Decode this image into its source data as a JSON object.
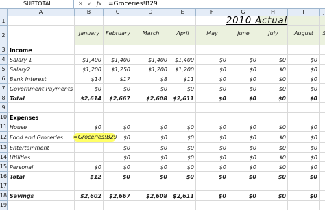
{
  "formula_bar": {
    "name_box": "SUBTOTAL",
    "cancel_icon": "✕",
    "enter_icon": "✓",
    "fx_label": "fx",
    "formula": "=Groceries!B29"
  },
  "columns": [
    "A",
    "B",
    "C",
    "D",
    "E",
    "F",
    "G",
    "H",
    "I",
    "J"
  ],
  "rows": [
    "1",
    "2",
    "3",
    "4",
    "5",
    "6",
    "7",
    "8",
    "9",
    "10",
    "11",
    "12",
    "13",
    "14",
    "15",
    "16",
    "17",
    "18",
    "19"
  ],
  "title": "2010 Actual",
  "months": [
    "January",
    "February",
    "March",
    "April",
    "May",
    "June",
    "July",
    "August",
    "S"
  ],
  "income": {
    "header": "Income",
    "rows": [
      {
        "label": "Salary 1",
        "values": [
          "$1,400",
          "$1,400",
          "$1,400",
          "$1,400",
          "$0",
          "$0",
          "$0",
          "$0"
        ]
      },
      {
        "label": "Salary2",
        "values": [
          "$1,200",
          "$1,250",
          "$1,200",
          "$1,200",
          "$0",
          "$0",
          "$0",
          "$0"
        ]
      },
      {
        "label": "Bank Interest",
        "values": [
          "$14",
          "$17",
          "$8",
          "$11",
          "$0",
          "$0",
          "$0",
          "$0"
        ]
      },
      {
        "label": "Government Payments",
        "values": [
          "$0",
          "$0",
          "$0",
          "$0",
          "$0",
          "$0",
          "$0",
          "$0"
        ]
      }
    ],
    "total": {
      "label": "Total",
      "values": [
        "$2,614",
        "$2,667",
        "$2,608",
        "$2,611",
        "$0",
        "$0",
        "$0",
        "$0"
      ]
    }
  },
  "expenses": {
    "header": "Expenses",
    "rows": [
      {
        "label": "House",
        "values": [
          "$0",
          "$0",
          "$0",
          "$0",
          "$0",
          "$0",
          "$0",
          "$0"
        ]
      },
      {
        "label": "Food and Groceries",
        "values": [
          "=Groceries!B29",
          "$0",
          "$0",
          "$0",
          "$0",
          "$0",
          "$0",
          "$0"
        ]
      },
      {
        "label": "Entertainment",
        "values": [
          "",
          "$0",
          "$0",
          "$0",
          "$0",
          "$0",
          "$0",
          "$0"
        ]
      },
      {
        "label": "Utilities",
        "values": [
          "",
          "$0",
          "$0",
          "$0",
          "$0",
          "$0",
          "$0",
          "$0"
        ]
      },
      {
        "label": "Personal",
        "values": [
          "$0",
          "$0",
          "$0",
          "$0",
          "$0",
          "$0",
          "$0",
          "$0"
        ]
      }
    ],
    "total": {
      "label": "Total",
      "values": [
        "$12",
        "$0",
        "$0",
        "$0",
        "$0",
        "$0",
        "$0",
        "$0"
      ]
    }
  },
  "savings": {
    "label": "Savings",
    "values": [
      "$2,602",
      "$2,667",
      "$2,608",
      "$2,611",
      "$0",
      "$0",
      "$0",
      "$0"
    ]
  }
}
